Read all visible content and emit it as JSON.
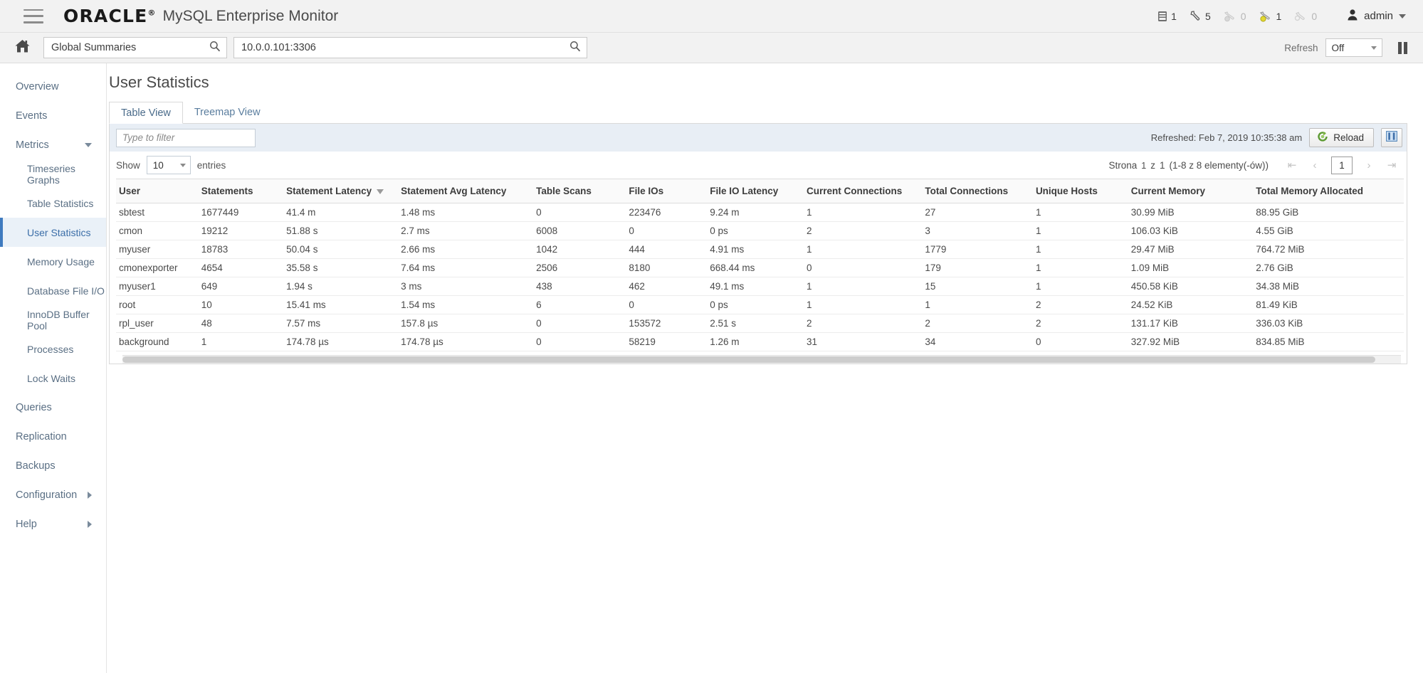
{
  "topbar": {
    "brand": "ORACLE",
    "brand_mark": "®",
    "product": "MySQL Enterprise Monitor",
    "menu_icon": "hamburger-icon",
    "stats": [
      {
        "icon": "server-icon",
        "value": "1",
        "dim": false
      },
      {
        "icon": "wrench-icon",
        "value": "5",
        "dim": false
      },
      {
        "icon": "critical-alert-icon",
        "value": "0",
        "dim": true
      },
      {
        "icon": "warning-alert-icon",
        "value": "1",
        "dim": false
      },
      {
        "icon": "notice-alert-icon",
        "value": "0",
        "dim": true
      }
    ],
    "user": "admin"
  },
  "searchrow": {
    "home_icon": "home-icon",
    "group_search": {
      "value": "Global Summaries",
      "placeholder": "Global Summaries",
      "icon": "search-icon"
    },
    "instance_search": {
      "value": "10.0.0.101:3306",
      "placeholder": "10.0.0.101:3306",
      "icon": "search-icon"
    },
    "refresh_label": "Refresh",
    "refresh_value": "Off",
    "pause_icon": "pause-icon"
  },
  "sidebar": {
    "items": [
      {
        "label": "Overview",
        "level": "top",
        "active": false,
        "arrow": ""
      },
      {
        "label": "Events",
        "level": "top",
        "active": false,
        "arrow": ""
      },
      {
        "label": "Metrics",
        "level": "top",
        "active": false,
        "arrow": "down"
      },
      {
        "label": "Timeseries Graphs",
        "level": "sub",
        "active": false,
        "arrow": ""
      },
      {
        "label": "Table Statistics",
        "level": "sub",
        "active": false,
        "arrow": ""
      },
      {
        "label": "User Statistics",
        "level": "sub",
        "active": true,
        "arrow": ""
      },
      {
        "label": "Memory Usage",
        "level": "sub",
        "active": false,
        "arrow": ""
      },
      {
        "label": "Database File I/O",
        "level": "sub",
        "active": false,
        "arrow": ""
      },
      {
        "label": "InnoDB Buffer Pool",
        "level": "sub",
        "active": false,
        "arrow": ""
      },
      {
        "label": "Processes",
        "level": "sub",
        "active": false,
        "arrow": ""
      },
      {
        "label": "Lock Waits",
        "level": "sub",
        "active": false,
        "arrow": ""
      },
      {
        "label": "Queries",
        "level": "top",
        "active": false,
        "arrow": ""
      },
      {
        "label": "Replication",
        "level": "top",
        "active": false,
        "arrow": ""
      },
      {
        "label": "Backups",
        "level": "top",
        "active": false,
        "arrow": ""
      },
      {
        "label": "Configuration",
        "level": "top",
        "active": false,
        "arrow": "right"
      },
      {
        "label": "Help",
        "level": "top",
        "active": false,
        "arrow": "right"
      }
    ]
  },
  "main": {
    "title": "User Statistics",
    "tabs": [
      {
        "label": "Table View",
        "active": true
      },
      {
        "label": "Treemap View",
        "active": false
      }
    ],
    "filter": {
      "placeholder": "Type to filter",
      "value": "",
      "refreshed_text": "Refreshed: Feb 7, 2019 10:35:38 am",
      "reload_label": "Reload",
      "reload_icon": "reload-icon",
      "columns_icon": "columns-icon"
    },
    "show_entries": {
      "show_label": "Show",
      "value": "10",
      "entries_label": "entries"
    },
    "pagination": {
      "page_word": "Strona",
      "current_page": "1",
      "of_word": "z",
      "total_pages": "1",
      "range_text": "(1-8 z 8 elementy(-ów))",
      "first_icon": "first-page-icon",
      "prev_icon": "prev-page-icon",
      "page_input": "1",
      "next_icon": "next-page-icon",
      "last_icon": "last-page-icon"
    },
    "table": {
      "sorted_column": "Statement Latency",
      "sort_direction": "desc",
      "columns": [
        "User",
        "Statements",
        "Statement Latency",
        "Statement Avg Latency",
        "Table Scans",
        "File IOs",
        "File IO Latency",
        "Current Connections",
        "Total Connections",
        "Unique Hosts",
        "Current Memory",
        "Total Memory Allocated"
      ],
      "rows": [
        [
          "sbtest",
          "1677449",
          "41.4 m",
          "1.48 ms",
          "0",
          "223476",
          "9.24 m",
          "1",
          "27",
          "1",
          "30.99 MiB",
          "88.95 GiB"
        ],
        [
          "cmon",
          "19212",
          "51.88 s",
          "2.7 ms",
          "6008",
          "0",
          "0 ps",
          "2",
          "3",
          "1",
          "106.03 KiB",
          "4.55 GiB"
        ],
        [
          "myuser",
          "18783",
          "50.04 s",
          "2.66 ms",
          "1042",
          "444",
          "4.91 ms",
          "1",
          "1779",
          "1",
          "29.47 MiB",
          "764.72 MiB"
        ],
        [
          "cmonexporter",
          "4654",
          "35.58 s",
          "7.64 ms",
          "2506",
          "8180",
          "668.44 ms",
          "0",
          "179",
          "1",
          "1.09 MiB",
          "2.76 GiB"
        ],
        [
          "myuser1",
          "649",
          "1.94 s",
          "3 ms",
          "438",
          "462",
          "49.1 ms",
          "1",
          "15",
          "1",
          "450.58 KiB",
          "34.38 MiB"
        ],
        [
          "root",
          "10",
          "15.41 ms",
          "1.54 ms",
          "6",
          "0",
          "0 ps",
          "1",
          "1",
          "2",
          "24.52 KiB",
          "81.49 KiB"
        ],
        [
          "rpl_user",
          "48",
          "7.57 ms",
          "157.8 µs",
          "0",
          "153572",
          "2.51 s",
          "2",
          "2",
          "2",
          "131.17 KiB",
          "336.03 KiB"
        ],
        [
          "background",
          "1",
          "174.78 µs",
          "174.78 µs",
          "0",
          "58219",
          "1.26 m",
          "31",
          "34",
          "0",
          "327.92 MiB",
          "834.85 MiB"
        ]
      ]
    }
  },
  "colors": {
    "accent": "#3f7bbf",
    "active_bg": "#eaf1f8",
    "filterbar_bg": "#e8eef5",
    "sidebar_text": "#5a6f84"
  }
}
